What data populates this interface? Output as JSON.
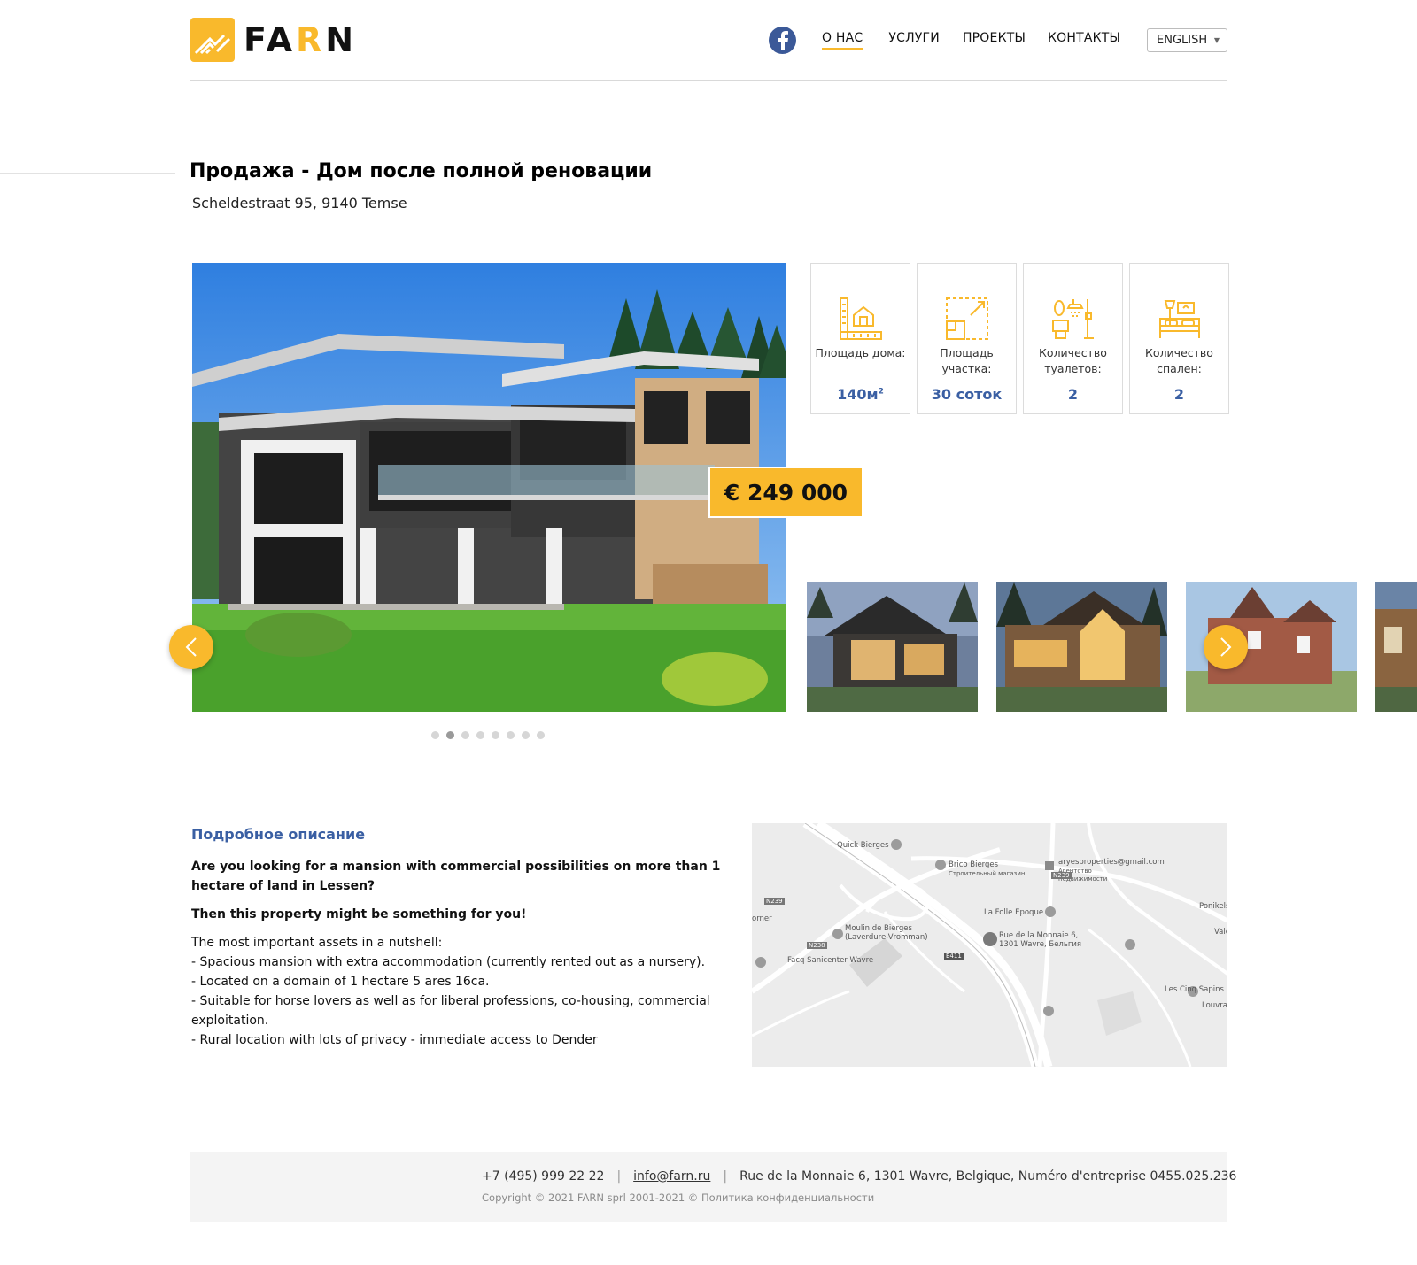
{
  "brand": {
    "logo_text_1": "FA",
    "logo_text_accent": "R",
    "logo_text_2": "N",
    "accent_color": "#f9b92c",
    "link_color": "#3a5fa3"
  },
  "nav": {
    "items": [
      {
        "label": "О НАС",
        "active": true
      },
      {
        "label": "УСЛУГИ",
        "active": false
      },
      {
        "label": "ПРОЕКТЫ",
        "active": false
      },
      {
        "label": "КОНТАКТЫ",
        "active": false
      }
    ],
    "language": "ENGLISH"
  },
  "listing": {
    "title": "Продажа - Дом после полной реновации",
    "address": "Scheldestraat 95, 9140 Temse",
    "price": "€ 249 000",
    "slides_count": 8,
    "active_slide": 2,
    "specs": [
      {
        "icon": "house-plan-icon",
        "label": "Площадь дома:",
        "value": "140м",
        "sup": "2"
      },
      {
        "icon": "plot-area-icon",
        "label": "Площадь участка:",
        "value": "30 соток",
        "sup": ""
      },
      {
        "icon": "bathroom-icon",
        "label": "Количество туалетов:",
        "value": "2",
        "sup": ""
      },
      {
        "icon": "bed-icon",
        "label": "Количество спален:",
        "value": "2",
        "sup": ""
      }
    ]
  },
  "description": {
    "title": "Подробное описание",
    "lead": "Are you looking for a mansion with commercial possibilities on more than 1 hectare of land in Lessen?",
    "hook": "Then this property might be something for you!",
    "lines": [
      "The most important assets in a nutshell:",
      "- Spacious mansion with extra accommodation (currently rented out as a nursery).",
      "- Located on a domain of 1 hectare 5 ares 16ca.",
      "- Suitable for horse lovers as well as for liberal professions, co-housing, commercial exploitation.",
      "- Rural location with lots of privacy - immediate access to Dender"
    ]
  },
  "map": {
    "labels": {
      "quick": "Quick Bierges",
      "brico": "Brico Bierges",
      "brico_sub": "Строительный магазин",
      "email": "aryesproperties@gmail.com",
      "agency_1": "Агентство",
      "agency_2": "недвижимости",
      "folle": "La Folle Epoque",
      "moulin_1": "Moulin de Bierges",
      "moulin_2": "(Laverdure-Vromman)",
      "monnaie_1": "Rue de la Monnaie 6,",
      "monnaie_2": "1301 Wavre, Бельгия",
      "facq": "Facq Sanicenter Wavre",
      "cinq": "Les Cinq Sapins",
      "louvrange": "Louvra",
      "ponikels": "Ponikels",
      "vale": "Valé",
      "orner": "orner",
      "n239a": "N239",
      "n239b": "N239",
      "n238": "N238",
      "e411": "E411"
    }
  },
  "footer": {
    "phone": "+7 (495) 999 22 22",
    "email": "info@farn.ru",
    "address": "Rue de la Monnaie 6, 1301 Wavre, Belgique, Numéro d'entreprise  0455.025.236",
    "copyright": "Copyright © 2021 FARN sprl  2001-2021 © Политика конфиденциальности",
    "separator": "|"
  }
}
